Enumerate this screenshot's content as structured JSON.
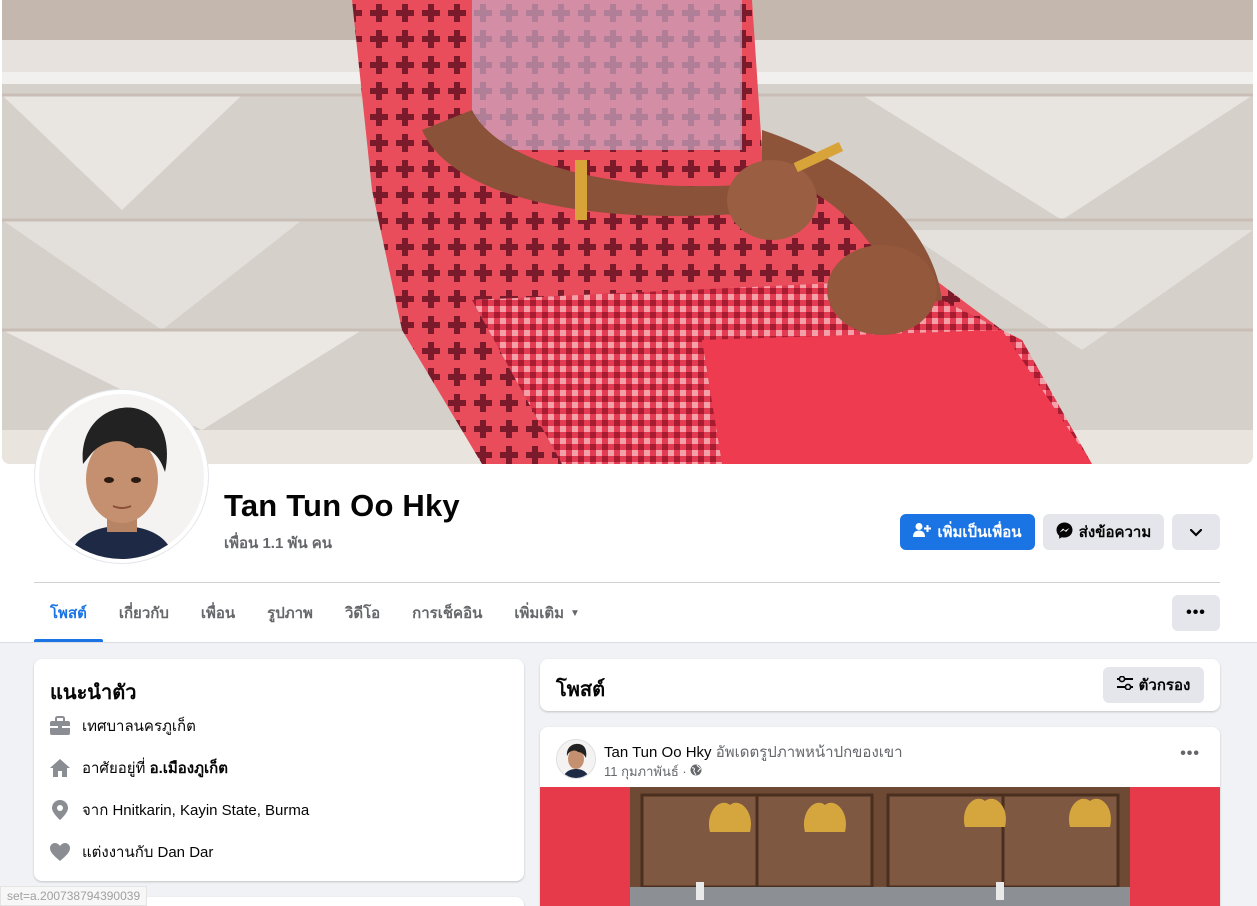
{
  "profile": {
    "name": "Tan Tun Oo Hky",
    "friends": "เพื่อน 1.1 พัน คน"
  },
  "actions": {
    "add_friend": "เพิ่มเป็นเพื่อน",
    "message": "ส่งข้อความ"
  },
  "tabs": [
    {
      "label": "โพสต์"
    },
    {
      "label": "เกี่ยวกับ"
    },
    {
      "label": "เพื่อน"
    },
    {
      "label": "รูปภาพ"
    },
    {
      "label": "วิดีโอ"
    },
    {
      "label": "การเช็คอิน"
    },
    {
      "label": "เพิ่มเติม"
    }
  ],
  "intro": {
    "title": "แนะนำตัว",
    "work": "เทศบาลนครภูเก็ต",
    "lives_prefix": "อาศัยอยู่ที่ ",
    "lives_place": "อ.เมืองภูเก็ต",
    "from": "จาก Hnitkarin, Kayin State, Burma",
    "relationship": "แต่งงานกับ Dan Dar"
  },
  "posts": {
    "title": "โพสต์",
    "filter_label": "ตัวกรอง"
  },
  "post": {
    "author": "Tan Tun Oo Hky",
    "action": " อัพเดตรูปภาพหน้าปกของเขา",
    "date": "11 กุมภาพันธ์ ·"
  },
  "status_url": "set=a.200738794390039",
  "colors": {
    "accent": "#1b74e4",
    "secondary_button": "#e4e6eb",
    "muted_text": "#65676b",
    "post_image_bg": "#e6394a"
  }
}
